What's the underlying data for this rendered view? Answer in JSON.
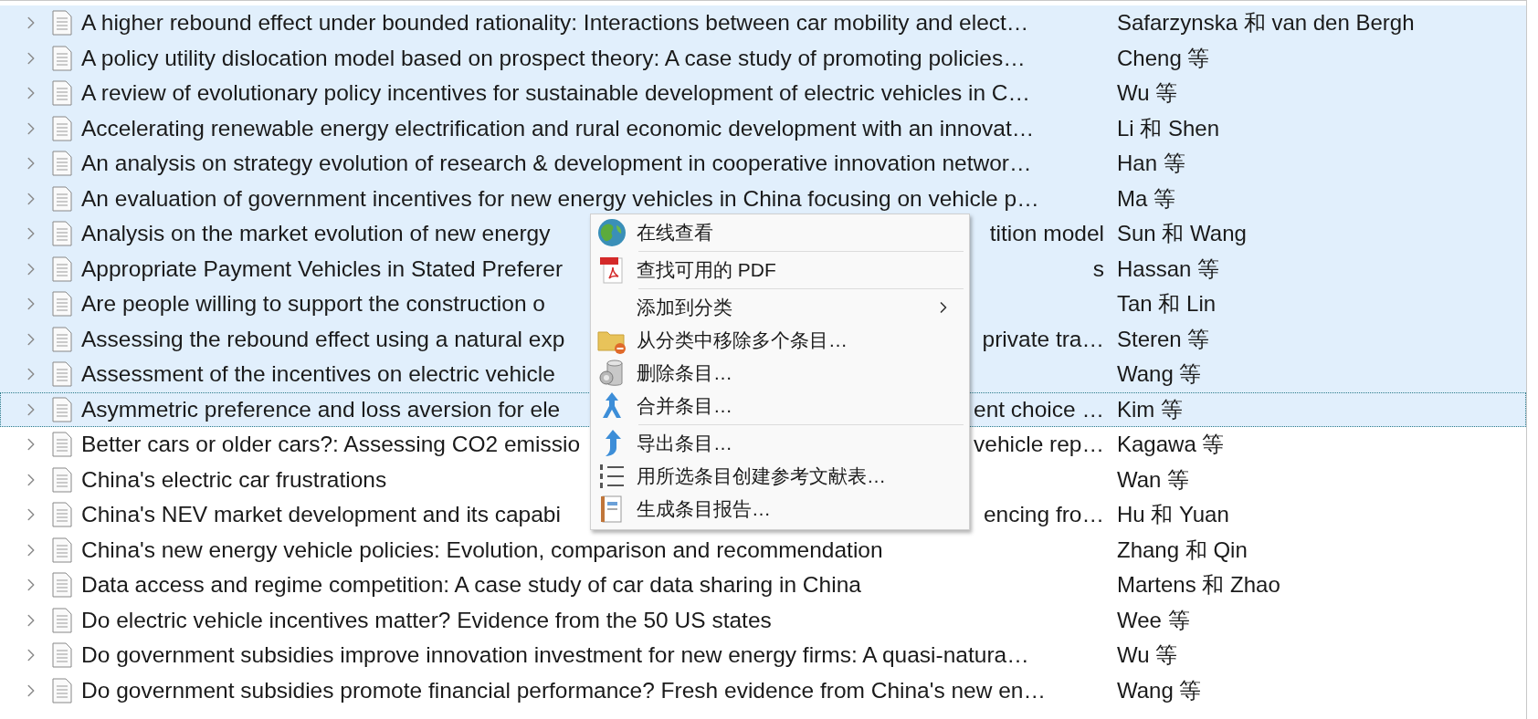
{
  "items": [
    {
      "title": "A higher rebound effect under bounded rationality: Interactions between car mobility and elect…",
      "author": "Safarzynska 和 van den Bergh",
      "selected": true,
      "focused": false
    },
    {
      "title": "A policy utility dislocation model based on prospect theory: A case study of promoting policies…",
      "author": "Cheng 等",
      "selected": true,
      "focused": false
    },
    {
      "title": "A review of evolutionary policy incentives for sustainable development of electric vehicles in C…",
      "author": "Wu 等",
      "selected": true,
      "focused": false
    },
    {
      "title": "Accelerating renewable energy electrification and rural economic development with an innovat…",
      "author": "Li 和 Shen",
      "selected": true,
      "focused": false
    },
    {
      "title": "An analysis on strategy evolution of research & development in cooperative innovation networ…",
      "author": "Han 等",
      "selected": true,
      "focused": false
    },
    {
      "title": "An evaluation of government incentives for new energy vehicles in China focusing on vehicle p…",
      "author": "Ma 等",
      "selected": true,
      "focused": false
    },
    {
      "title": "Analysis on the market evolution of new energy",
      "title_end": "tition model",
      "author": "Sun 和 Wang",
      "selected": true,
      "focused": false
    },
    {
      "title": "Appropriate Payment Vehicles in Stated Preferer",
      "title_end": "s",
      "author": "Hassan 等",
      "selected": true,
      "focused": false
    },
    {
      "title": "Are people willing to support the construction o",
      "author": "Tan 和 Lin",
      "selected": true,
      "focused": false
    },
    {
      "title": "Assessing the rebound effect using a natural exp",
      "title_end": "private tra…",
      "author": "Steren 等",
      "selected": true,
      "focused": false
    },
    {
      "title": "Assessment of the incentives on electric vehicle",
      "author": "Wang 等",
      "selected": true,
      "focused": false
    },
    {
      "title": "Asymmetric preference and loss aversion for ele",
      "title_end": "ent choice …",
      "author": "Kim 等",
      "selected": true,
      "focused": true
    },
    {
      "title": "Better cars or older cars?: Assessing CO2 emissio",
      "title_end": "vehicle rep…",
      "author": "Kagawa 等",
      "selected": false,
      "focused": false
    },
    {
      "title": "China's electric car frustrations",
      "author": "Wan 等",
      "selected": false,
      "focused": false
    },
    {
      "title": "China's NEV market development and its capabi",
      "title_end": "encing fro…",
      "author": "Hu 和 Yuan",
      "selected": false,
      "focused": false
    },
    {
      "title": "China's new energy vehicle policies: Evolution, comparison and recommendation",
      "author": "Zhang 和 Qin",
      "selected": false,
      "focused": false
    },
    {
      "title": "Data access and regime competition: A case study of car data sharing in China",
      "author": "Martens 和 Zhao",
      "selected": false,
      "focused": false
    },
    {
      "title": "Do electric vehicle incentives matter? Evidence from the 50 US states",
      "author": "Wee 等",
      "selected": false,
      "focused": false
    },
    {
      "title": "Do government subsidies improve innovation investment for new energy firms: A quasi-natura…",
      "author": "Wu 等",
      "selected": false,
      "focused": false
    },
    {
      "title": "Do government subsidies promote financial performance? Fresh evidence from China's new en…",
      "author": "Wang 等",
      "selected": false,
      "focused": false
    }
  ],
  "context_menu": {
    "groups": [
      [
        {
          "label": "在线查看",
          "submenu": false
        }
      ],
      [
        {
          "label": "查找可用的 PDF",
          "submenu": false
        }
      ],
      [
        {
          "label": "添加到分类",
          "submenu": true
        },
        {
          "label": "从分类中移除多个条目…",
          "submenu": false
        },
        {
          "label": "删除条目…",
          "submenu": false
        },
        {
          "label": "合并条目…",
          "submenu": false
        }
      ],
      [
        {
          "label": "导出条目…",
          "submenu": false
        },
        {
          "label": "用所选条目创建参考文献表…",
          "submenu": false
        },
        {
          "label": "生成条目报告…",
          "submenu": false
        }
      ]
    ]
  }
}
